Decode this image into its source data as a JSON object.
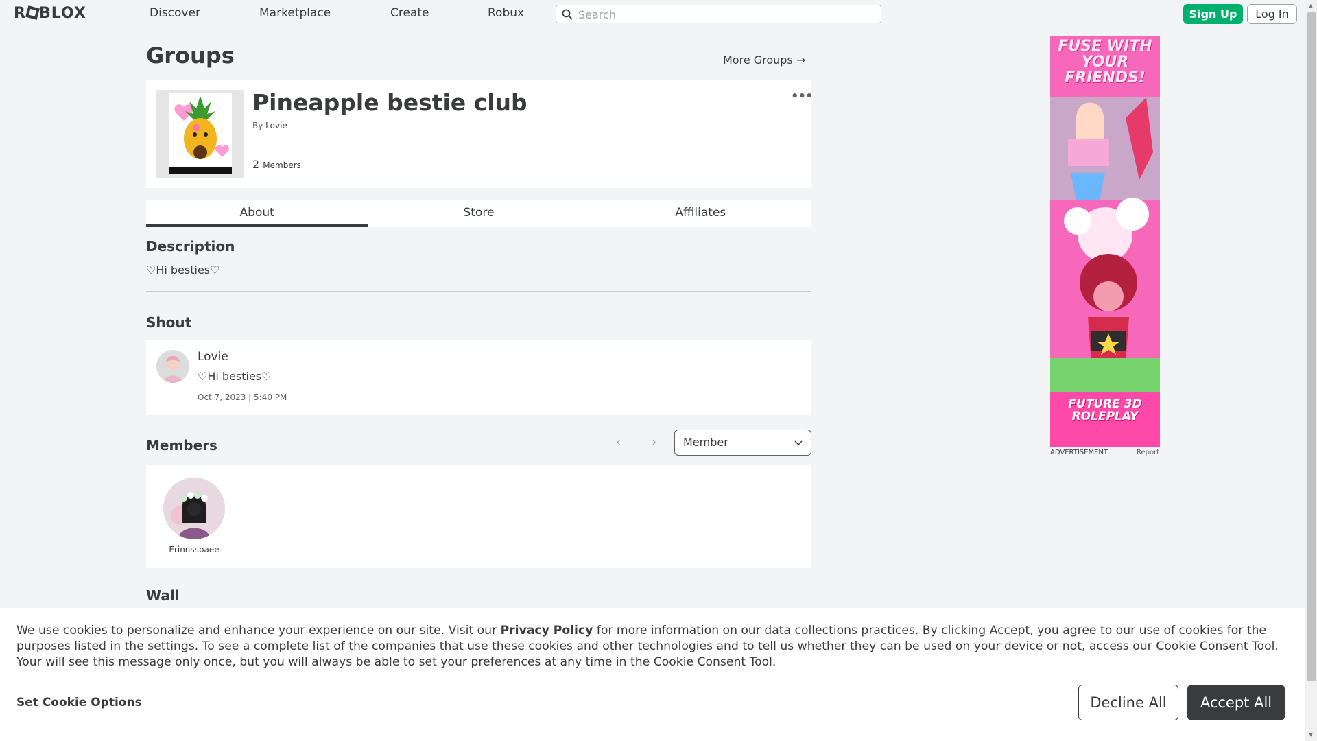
{
  "nav": {
    "logo": "ROBLOX",
    "links": [
      "Discover",
      "Marketplace",
      "Create",
      "Robux"
    ],
    "search_placeholder": "Search",
    "signup_label": "Sign Up",
    "login_label": "Log In"
  },
  "page": {
    "title": "Groups",
    "more_groups_label": "More Groups →"
  },
  "group": {
    "name": "Pineapple bestie club",
    "by_prefix": "By",
    "owner": "Lovie",
    "member_count": "2",
    "members_label": "Members",
    "menu_icon": "more-dots-icon"
  },
  "tabs": [
    {
      "label": "About",
      "active": true
    },
    {
      "label": "Store",
      "active": false
    },
    {
      "label": "Affiliates",
      "active": false
    }
  ],
  "description": {
    "title": "Description",
    "text": "♡Hi besties♡"
  },
  "shout": {
    "title": "Shout",
    "author": "Lovie",
    "text": "♡Hi besties♡",
    "date": "Oct 7, 2023 | 5:40 PM"
  },
  "members": {
    "title": "Members",
    "role_selected": "Member",
    "list": [
      {
        "name": "Erinnssbaee"
      }
    ]
  },
  "wall": {
    "title": "Wall"
  },
  "ad": {
    "headline": "FUSE WITH YOUR FRIENDS!",
    "subline": "FUTURE 3D ROLEPLAY",
    "label": "ADVERTISEMENT",
    "report_label": "Report"
  },
  "cookie": {
    "text_before_link": "We use cookies to personalize and enhance your experience on our site. Visit our ",
    "link_text": "Privacy Policy",
    "text_after_link": " for more information on our data collections practices. By clicking Accept, you agree to our use of cookies for the purposes listed in the settings. To see a complete list of the companies that use these cookies and other technologies and to tell us whether they can be used on your device or not, access our Cookie Consent Tool. Your will see this message only once, but you will always be able to set your preferences at any time in the Cookie Consent Tool.",
    "options_label": "Set Cookie Options",
    "decline_label": "Decline All",
    "accept_label": "Accept All"
  },
  "colors": {
    "background": "#f2f4f5",
    "card": "#ffffff",
    "text": "#393b3d",
    "signup_green": "#00b06f",
    "accept_dark": "#393b3d",
    "ad_pink": "#f45bb2"
  }
}
